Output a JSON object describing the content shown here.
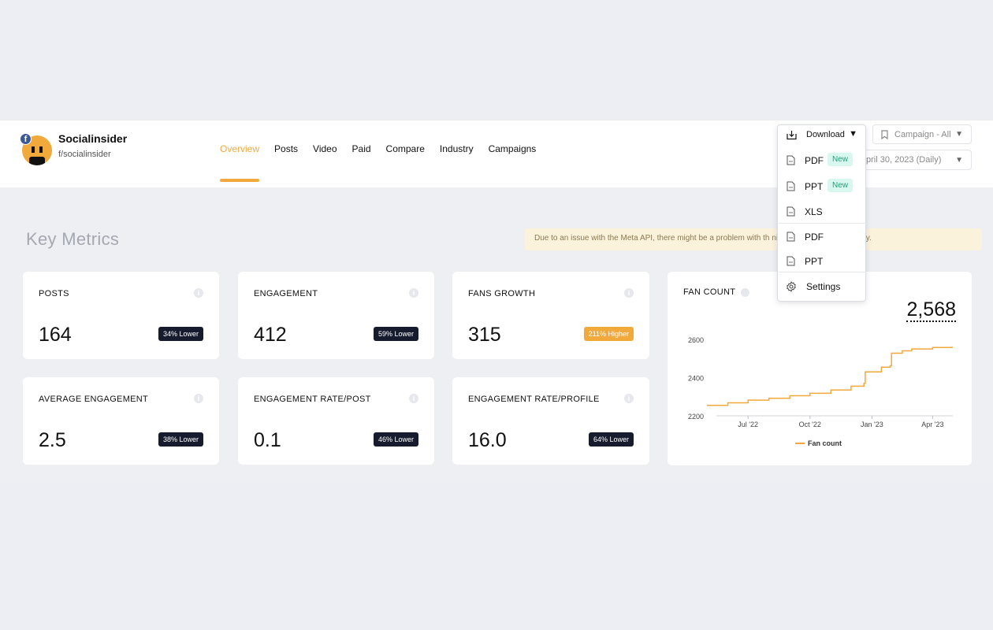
{
  "brand": {
    "name": "Socialinsider",
    "handle": "f/socialinsider"
  },
  "nav": {
    "items": [
      "Overview",
      "Posts",
      "Video",
      "Paid",
      "Compare",
      "Industry",
      "Campaigns"
    ],
    "active": "Overview"
  },
  "toolbar": {
    "campaign_label": "Campaign - All",
    "date_label": "pril 30, 2023 (Daily)"
  },
  "download_menu": {
    "title": "Download",
    "items": [
      {
        "label": "PDF",
        "badge": "New"
      },
      {
        "label": "PPT",
        "badge": "New"
      },
      {
        "label": "XLS"
      },
      {
        "label": "PDF"
      },
      {
        "label": "PPT"
      },
      {
        "label": "Settings"
      }
    ]
  },
  "page": {
    "title": "Key Metrics"
  },
  "notice": {
    "text": "Due to an issue with the Meta API, there might be a problem with th                                                          nitoring this situation closely."
  },
  "metrics": [
    {
      "label": "POSTS",
      "value": "164",
      "badge": "34% Lower"
    },
    {
      "label": "ENGAGEMENT",
      "value": "412",
      "badge": "59% Lower"
    },
    {
      "label": "FANS GROWTH",
      "value": "315",
      "badge": "211% Higher"
    },
    {
      "label": "AVERAGE ENGAGEMENT",
      "value": "2.5",
      "badge": "38% Lower"
    },
    {
      "label": "ENGAGEMENT RATE/POST",
      "value": "0.1",
      "badge": "46% Lower"
    },
    {
      "label": "ENGAGEMENT RATE/PROFILE",
      "value": "16.0",
      "badge": "64% Lower"
    }
  ],
  "fan_count": {
    "label": "FAN COUNT",
    "value": "2,568"
  },
  "colors": {
    "accent": "#f2a93b",
    "dark_badge": "#161b2e",
    "new_badge_bg": "#d8f7ee",
    "new_badge_text": "#1fa37a"
  },
  "chart_data": {
    "type": "line",
    "title": "",
    "xlabel": "",
    "ylabel": "",
    "x_ticks": [
      "Jul '22",
      "Oct '22",
      "Jan '23",
      "Apr '23"
    ],
    "y_ticks": [
      2200,
      2400,
      2600
    ],
    "ylim": [
      2200,
      2600
    ],
    "x": [
      "2022-05-01",
      "2022-06-01",
      "2022-07-01",
      "2022-08-01",
      "2022-09-01",
      "2022-10-01",
      "2022-11-01",
      "2022-12-01",
      "2022-12-20",
      "2022-12-22",
      "2023-01-15",
      "2023-01-28",
      "2023-01-30",
      "2023-02-15",
      "2023-03-01",
      "2023-04-01",
      "2023-04-30"
    ],
    "series": [
      {
        "name": "Fan count",
        "values": [
          2255,
          2268,
          2282,
          2292,
          2305,
          2318,
          2335,
          2355,
          2370,
          2430,
          2455,
          2462,
          2528,
          2540,
          2550,
          2558,
          2562
        ]
      }
    ],
    "grid": false,
    "legend": "bottom"
  }
}
